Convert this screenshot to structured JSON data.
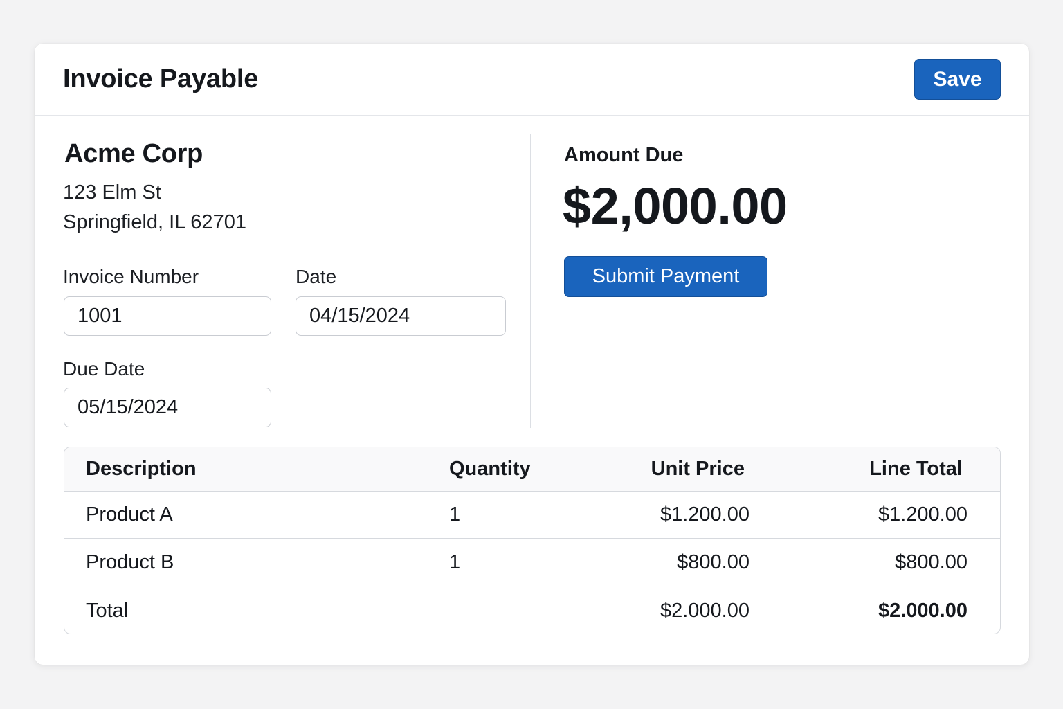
{
  "header": {
    "title": "Invoice Payable",
    "save_label": "Save"
  },
  "vendor": {
    "name": "Acme Corp",
    "address_line1": "123 Elm St",
    "address_line2": "Springfield, IL 62701"
  },
  "fields": {
    "invoice_number": {
      "label": "Invoice Number",
      "value": "1001"
    },
    "date": {
      "label": "Date",
      "value": "04/15/2024"
    },
    "due_date": {
      "label": "Due Date",
      "value": "05/15/2024"
    }
  },
  "payment": {
    "amount_label": "Amount Due",
    "amount_value": "$2,000.00",
    "submit_label": "Submit Payment"
  },
  "table": {
    "columns": [
      "Description",
      "Quantity",
      "Unit Price",
      "Line Total"
    ],
    "rows": [
      {
        "description": "Product A",
        "quantity": "1",
        "unit_price": "$1.200.00",
        "line_total": "$1.200.00"
      },
      {
        "description": "Product B",
        "quantity": "1",
        "unit_price": "$800.00",
        "line_total": "$800.00"
      }
    ],
    "total": {
      "label": "Total",
      "unit_price": "$2.000.00",
      "line_total": "$2.000.00"
    }
  },
  "colors": {
    "accent": "#1a64bd",
    "background": "#f3f3f4",
    "card": "#ffffff",
    "border": "#d6d9de"
  }
}
